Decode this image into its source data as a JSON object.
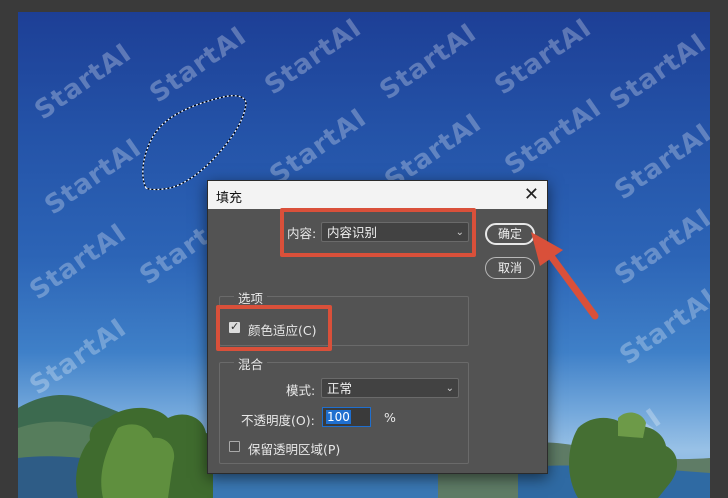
{
  "watermark": "StartAI",
  "dialog": {
    "title": "填充",
    "close_glyph": "✕",
    "content_label": "内容:",
    "content_value": "内容识别",
    "ok_label": "确定",
    "cancel_label": "取消",
    "options_group": "选项",
    "color_adapt_label": "颜色适应(C)",
    "color_adapt_checked": true,
    "blend_group": "混合",
    "mode_label": "模式:",
    "mode_value": "正常",
    "opacity_label": "不透明度(O):",
    "opacity_value": "100",
    "opacity_unit": "%",
    "preserve_label": "保留透明区域(P)",
    "preserve_checked": false
  },
  "colors": {
    "annotation": "#d9503a",
    "dialog_bg": "#535353",
    "input_focus": "#1f6fcf"
  }
}
